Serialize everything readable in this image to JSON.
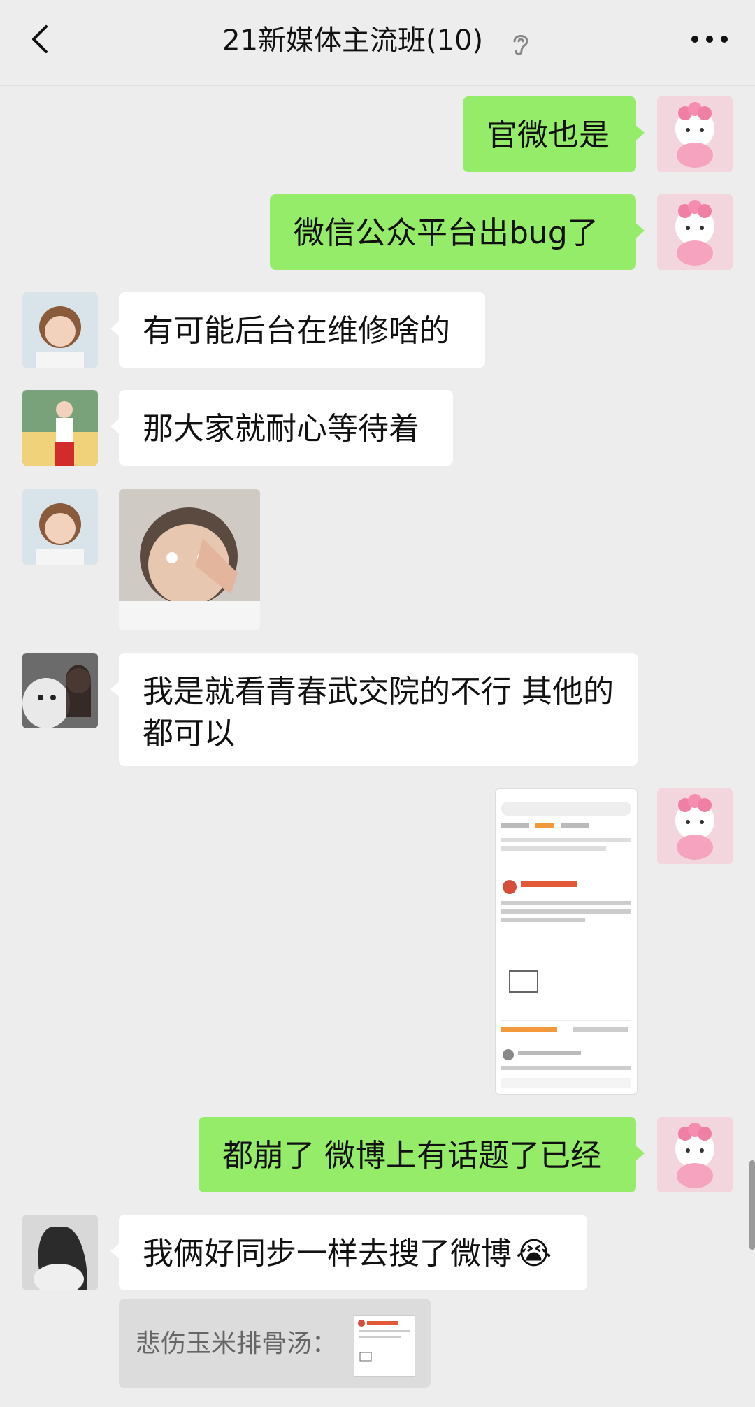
{
  "header": {
    "title": "21新媒体主流班(10)",
    "back_icon": "chevron-left-icon",
    "ear_icon": "ear-icon",
    "more_icon": "more-dots-icon"
  },
  "messages": [
    {
      "side": "right",
      "text": "官微也是"
    },
    {
      "side": "right",
      "text": "微信公众平台出bug了"
    },
    {
      "side": "left",
      "text": "有可能后台在维修啥的"
    },
    {
      "side": "left",
      "text": "那大家就耐心等待着"
    },
    {
      "side": "left",
      "type": "image",
      "description": ""
    },
    {
      "side": "left",
      "text": "我是就看青春武交院的不行  其他的都可以"
    },
    {
      "side": "right",
      "type": "image"
    },
    {
      "side": "right",
      "text": "都崩了 微博上有话题了已经"
    },
    {
      "side": "left",
      "text": "我俩好同步一样去搜了微博",
      "emoji": "😭"
    }
  ],
  "quote": {
    "author": "悲伤玉米排骨汤："
  },
  "colors": {
    "bg": "#ededed",
    "right_bubble": "#95ec69",
    "left_bubble": "#ffffff",
    "quote_bg": "#dcdcdc"
  }
}
